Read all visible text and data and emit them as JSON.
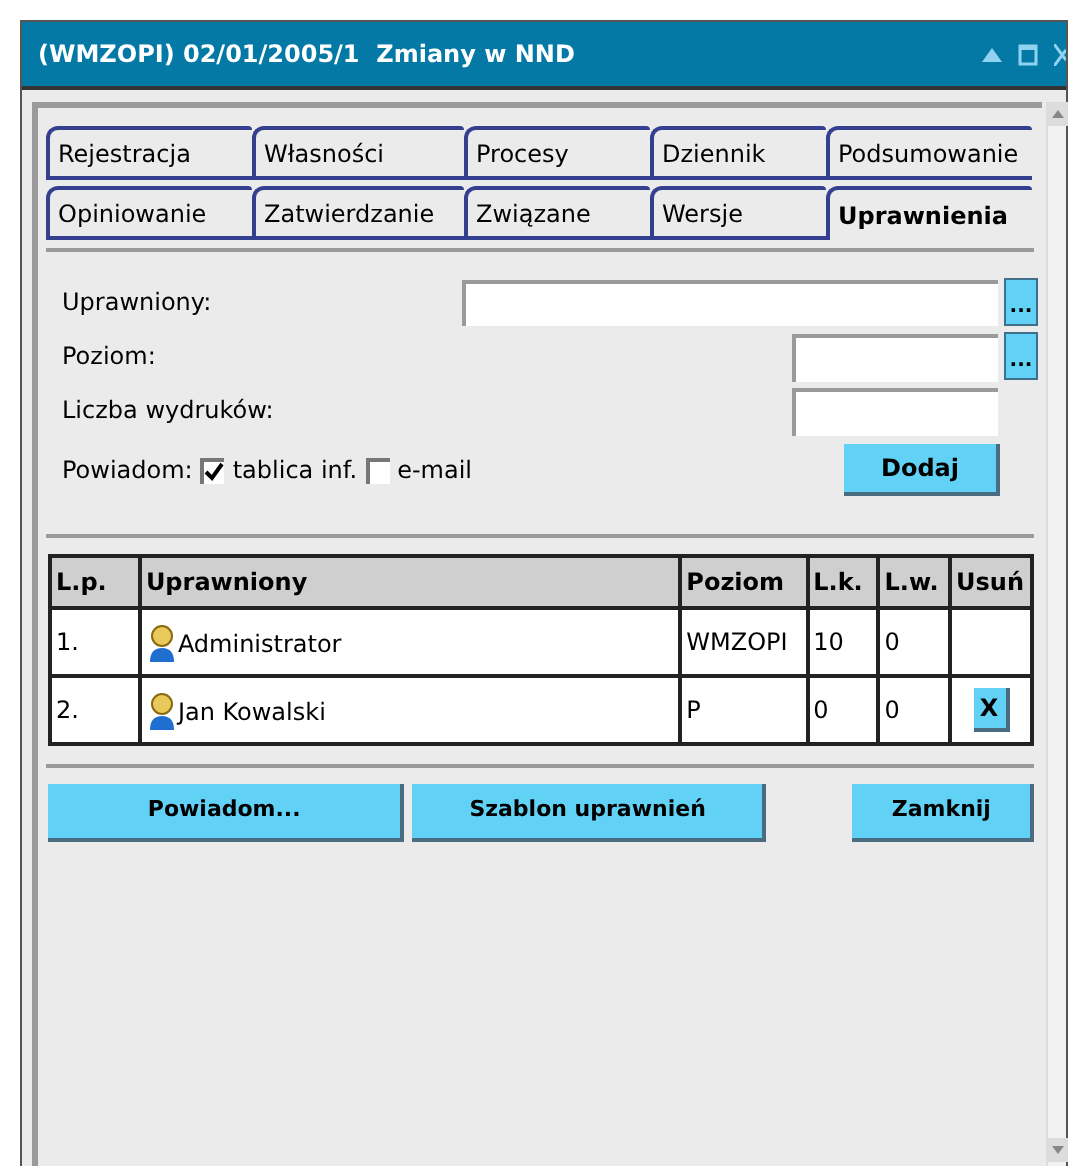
{
  "window": {
    "title": "(WMZOPI) 02/01/2005/1  Zmiany w NND"
  },
  "tabs": [
    [
      {
        "label": "Rejestracja",
        "selected": false
      },
      {
        "label": "Własności",
        "selected": false
      },
      {
        "label": "Procesy",
        "selected": false
      },
      {
        "label": "Dziennik",
        "selected": false
      },
      {
        "label": "Podsumowanie",
        "selected": false
      }
    ],
    [
      {
        "label": "Opiniowanie",
        "selected": false
      },
      {
        "label": "Zatwierdzanie",
        "selected": false
      },
      {
        "label": "Związane",
        "selected": false
      },
      {
        "label": "Wersje",
        "selected": false
      },
      {
        "label": "Uprawnienia",
        "selected": true
      }
    ]
  ],
  "form": {
    "uprawniony_label": "Uprawniony:",
    "uprawniony_browse": "...",
    "poziom_label": "Poziom:",
    "poziom_browse": "...",
    "liczba_label": "Liczba wydruków:",
    "powiadom_label": "Powiadom:",
    "notify": [
      {
        "label": "tablica inf.",
        "checked": true
      },
      {
        "label": "e-mail",
        "checked": false
      }
    ],
    "add_button": "Dodaj"
  },
  "table": {
    "columns": [
      "L.p.",
      "Uprawniony",
      "Poziom",
      "L.k.",
      "L.w.",
      "Usuń"
    ],
    "rows": [
      {
        "lp": "1.",
        "name": "Administrator",
        "level": "WMZOPI",
        "lk": "10",
        "lw": "0"
      },
      {
        "lp": "2.",
        "name": "Jan Kowalski",
        "level": "P",
        "lk": "0",
        "lw": "0",
        "delete": "X"
      }
    ]
  },
  "buttons": [
    "Powiadom...",
    "Szablon uprawnień",
    "Zamknij"
  ]
}
